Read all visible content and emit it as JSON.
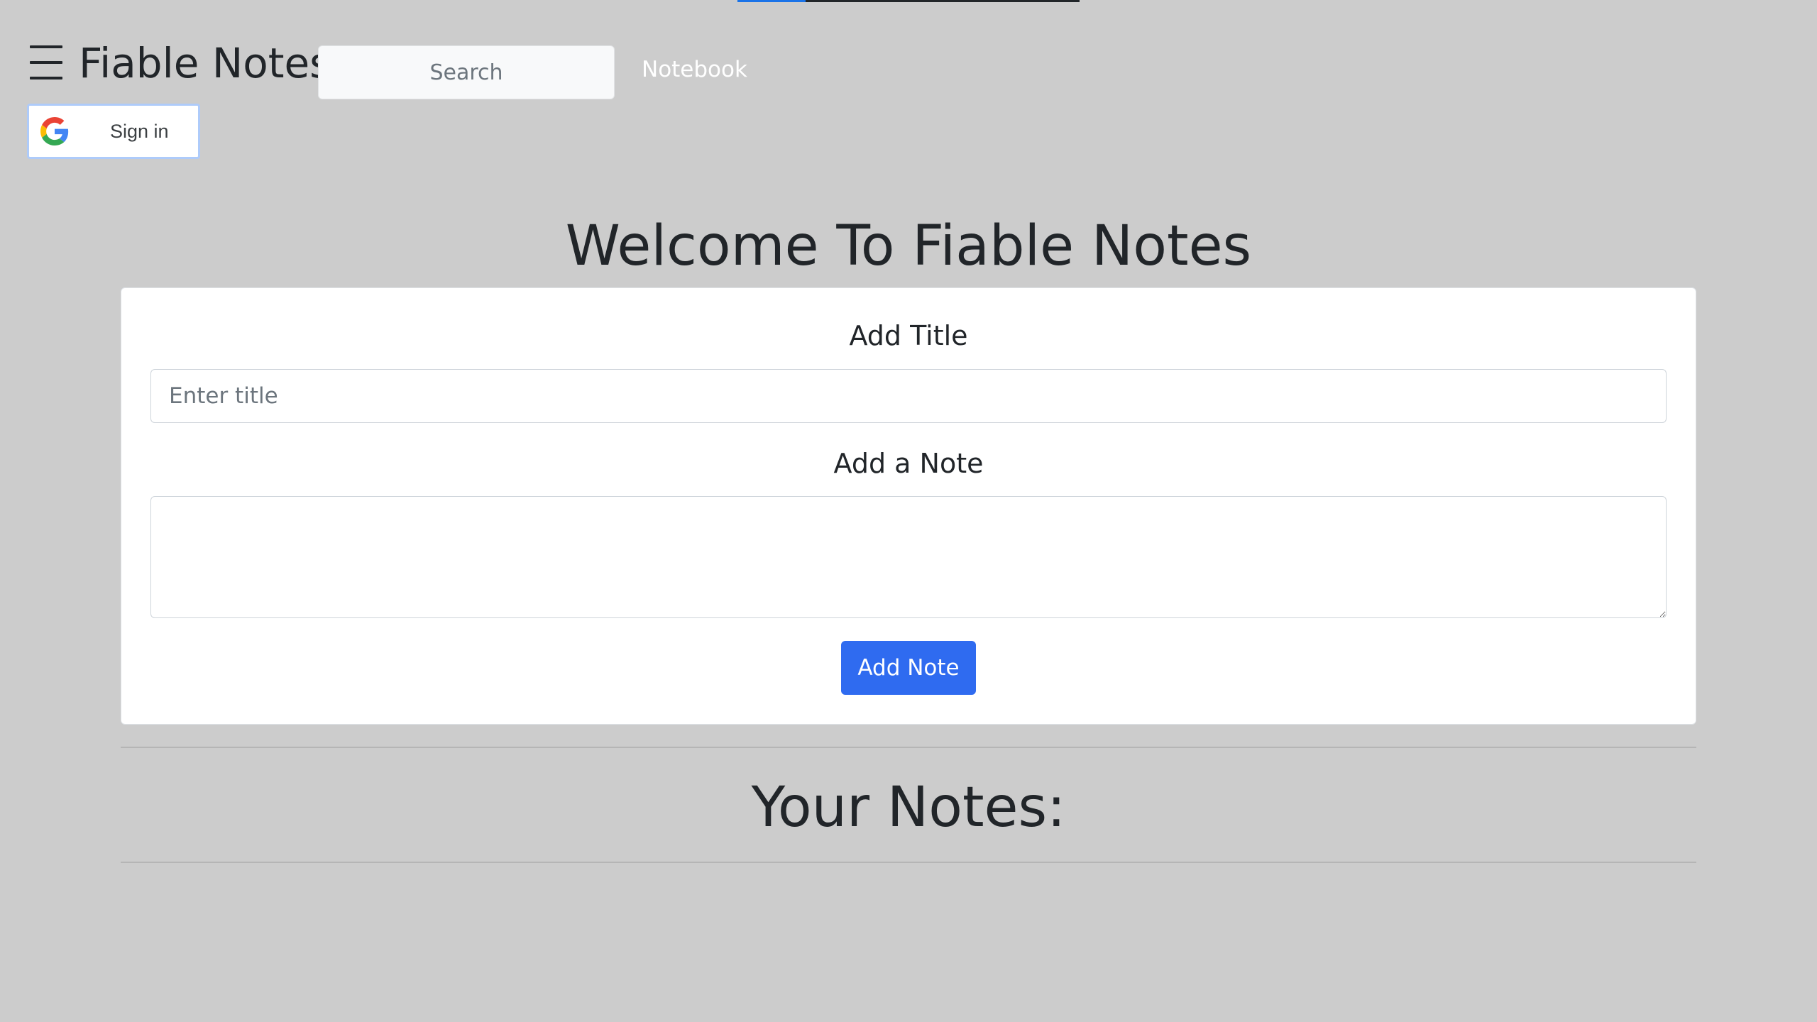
{
  "progress": {
    "fraction": 0.2,
    "track_color": "#212529",
    "fill_color": "#1a73e8"
  },
  "navbar": {
    "menu_icon": "hamburger-menu-icon",
    "brand": "Fiable Notes",
    "search_placeholder": "Search",
    "nav_link": "Notebook"
  },
  "google_signin": {
    "icon": "google-g-icon",
    "label": "Sign in"
  },
  "main": {
    "heading": "Welcome To Fiable Notes",
    "form": {
      "title_label": "Add Title",
      "title_placeholder": "Enter title",
      "title_value": "",
      "note_label": "Add a Note",
      "note_value": "",
      "submit_label": "Add Note"
    },
    "notes_heading": "Your Notes:",
    "notes": []
  },
  "colors": {
    "background": "#cccccc",
    "accent": "#2f6bf0",
    "card": "#ffffff"
  }
}
